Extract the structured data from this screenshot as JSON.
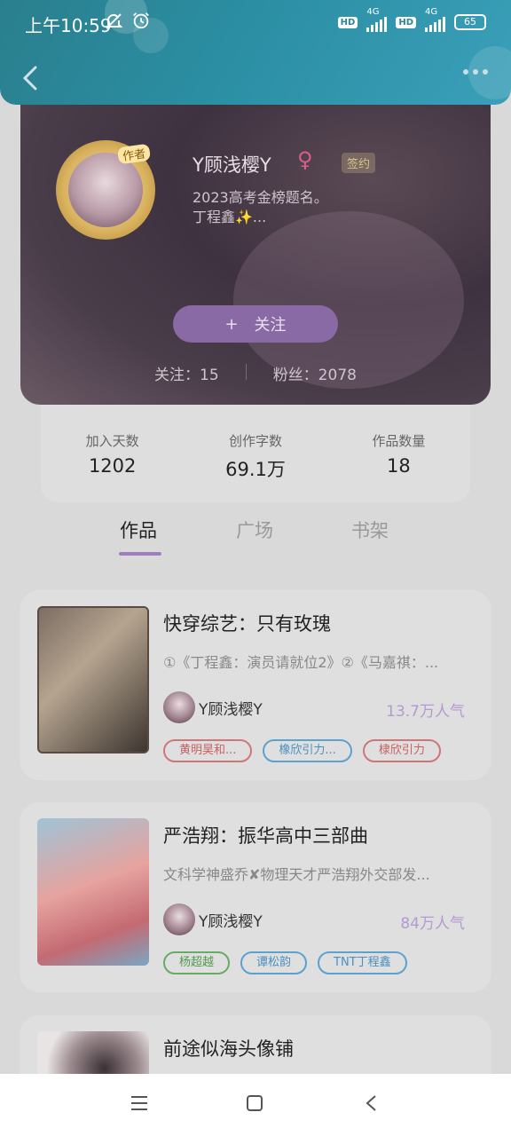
{
  "status": {
    "time": "上午10:59",
    "network1": "4G",
    "network2": "4G",
    "hd1": "HD",
    "hd2": "HD",
    "battery": "65"
  },
  "header": {
    "back_icon": "chevron-left-icon",
    "more_icon": "more-horizontal-icon"
  },
  "profile": {
    "author_badge": "作者",
    "name": "Y顾浅樱Y",
    "gender_symbol": "♀",
    "signed_label": "签约",
    "bio": "2023高考金榜题名。\n丁程鑫✨...",
    "follow_plus": "+",
    "follow_label": "关注",
    "following": "关注：15",
    "fans": "粉丝：2078"
  },
  "stats": [
    {
      "label": "加入天数",
      "value": "1202"
    },
    {
      "label": "创作字数",
      "value": "69.1万"
    },
    {
      "label": "作品数量",
      "value": "18"
    }
  ],
  "tabs": [
    {
      "label": "作品",
      "active": true
    },
    {
      "label": "广场",
      "active": false
    },
    {
      "label": "书架",
      "active": false
    }
  ],
  "books": [
    {
      "title": "快穿综艺：只有玫瑰",
      "desc": "①《丁程鑫：演员请就位2》②《马嘉祺：...",
      "author": "Y顾浅樱Y",
      "popularity": "13.7万人气",
      "tags": [
        {
          "label": "黄明昊和...",
          "color": "red"
        },
        {
          "label": "橡欣引力...",
          "color": "blue"
        },
        {
          "label": "棣欣引力",
          "color": "red"
        }
      ]
    },
    {
      "title": "严浩翔：振华高中三部曲",
      "desc": "文科学神盛乔✘物理天才严浩翔外交部发...",
      "author": "Y顾浅樱Y",
      "popularity": "84万人气",
      "tags": [
        {
          "label": "杨超越",
          "color": "green"
        },
        {
          "label": "谭松韵",
          "color": "blue"
        },
        {
          "label": "TNT丁程鑫",
          "color": "blue"
        }
      ]
    },
    {
      "title": "前途似海头像铺"
    }
  ],
  "navbar": {
    "menu_icon": "menu-icon",
    "home_icon": "square-home-icon",
    "back_icon": "triangle-back-icon"
  },
  "colors": {
    "header": "#2b8ea3",
    "accent": "#9d7fc0",
    "follow_button": "#8a6aa4"
  }
}
